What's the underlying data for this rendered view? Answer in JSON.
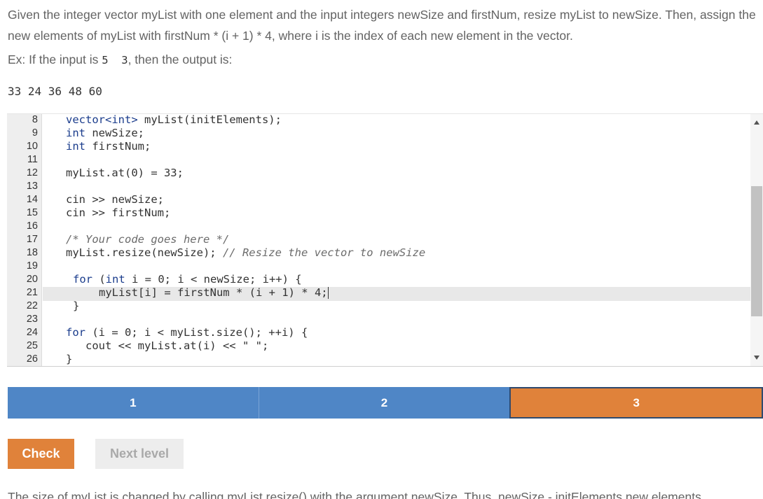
{
  "prompt": {
    "text": "Given the integer vector myList with one element and the input integers newSize and firstNum, resize myList to newSize. Then, assign the new elements of myList with firstNum * (i + 1) * 4, where i is the index of each new element in the vector.",
    "example_prefix": "Ex: If the input is ",
    "example_input": "5  3",
    "example_suffix": ", then the output is:",
    "example_output": "33 24 36 48 60"
  },
  "editor": {
    "line_numbers": [
      "8",
      "9",
      "10",
      "11",
      "12",
      "13",
      "14",
      "15",
      "16",
      "17",
      "18",
      "19",
      "20",
      "21",
      "22",
      "23",
      "24",
      "25",
      "26"
    ],
    "code": {
      "l8_a": "vector<int>",
      "l8_b": " myList(initElements);",
      "l9_a": "int",
      "l9_b": " newSize;",
      "l10_a": "int",
      "l10_b": " firstNum;",
      "l12": "myList.at(0) = 33;",
      "l14": "cin >> newSize;",
      "l15": "cin >> firstNum;",
      "l17": "/* Your code goes here */",
      "l18_a": "myList.resize(newSize); ",
      "l18_b": "// Resize the vector to newSize",
      "l20_a": "for",
      "l20_b": " (",
      "l20_c": "int",
      "l20_d": " i = 0; i < newSize; i++) {",
      "l21": "myList[i] = firstNum * (i + 1) * 4;",
      "l22": "}",
      "l24_a": "for",
      "l24_b": " (i = 0; i < myList.size(); ++i) {",
      "l25": "cout << myList.at(i) << \" \";",
      "l26": "}"
    }
  },
  "levels": {
    "items": [
      "1",
      "2",
      "3"
    ],
    "current": "3",
    "colors": {
      "default": "#4f86c6",
      "current": "#e0823a"
    }
  },
  "buttons": {
    "check": "Check",
    "next_level": "Next level"
  },
  "explanation": "The size of myList is changed by calling myList.resize() with the argument newSize. Thus, newSize - initElements new elements"
}
